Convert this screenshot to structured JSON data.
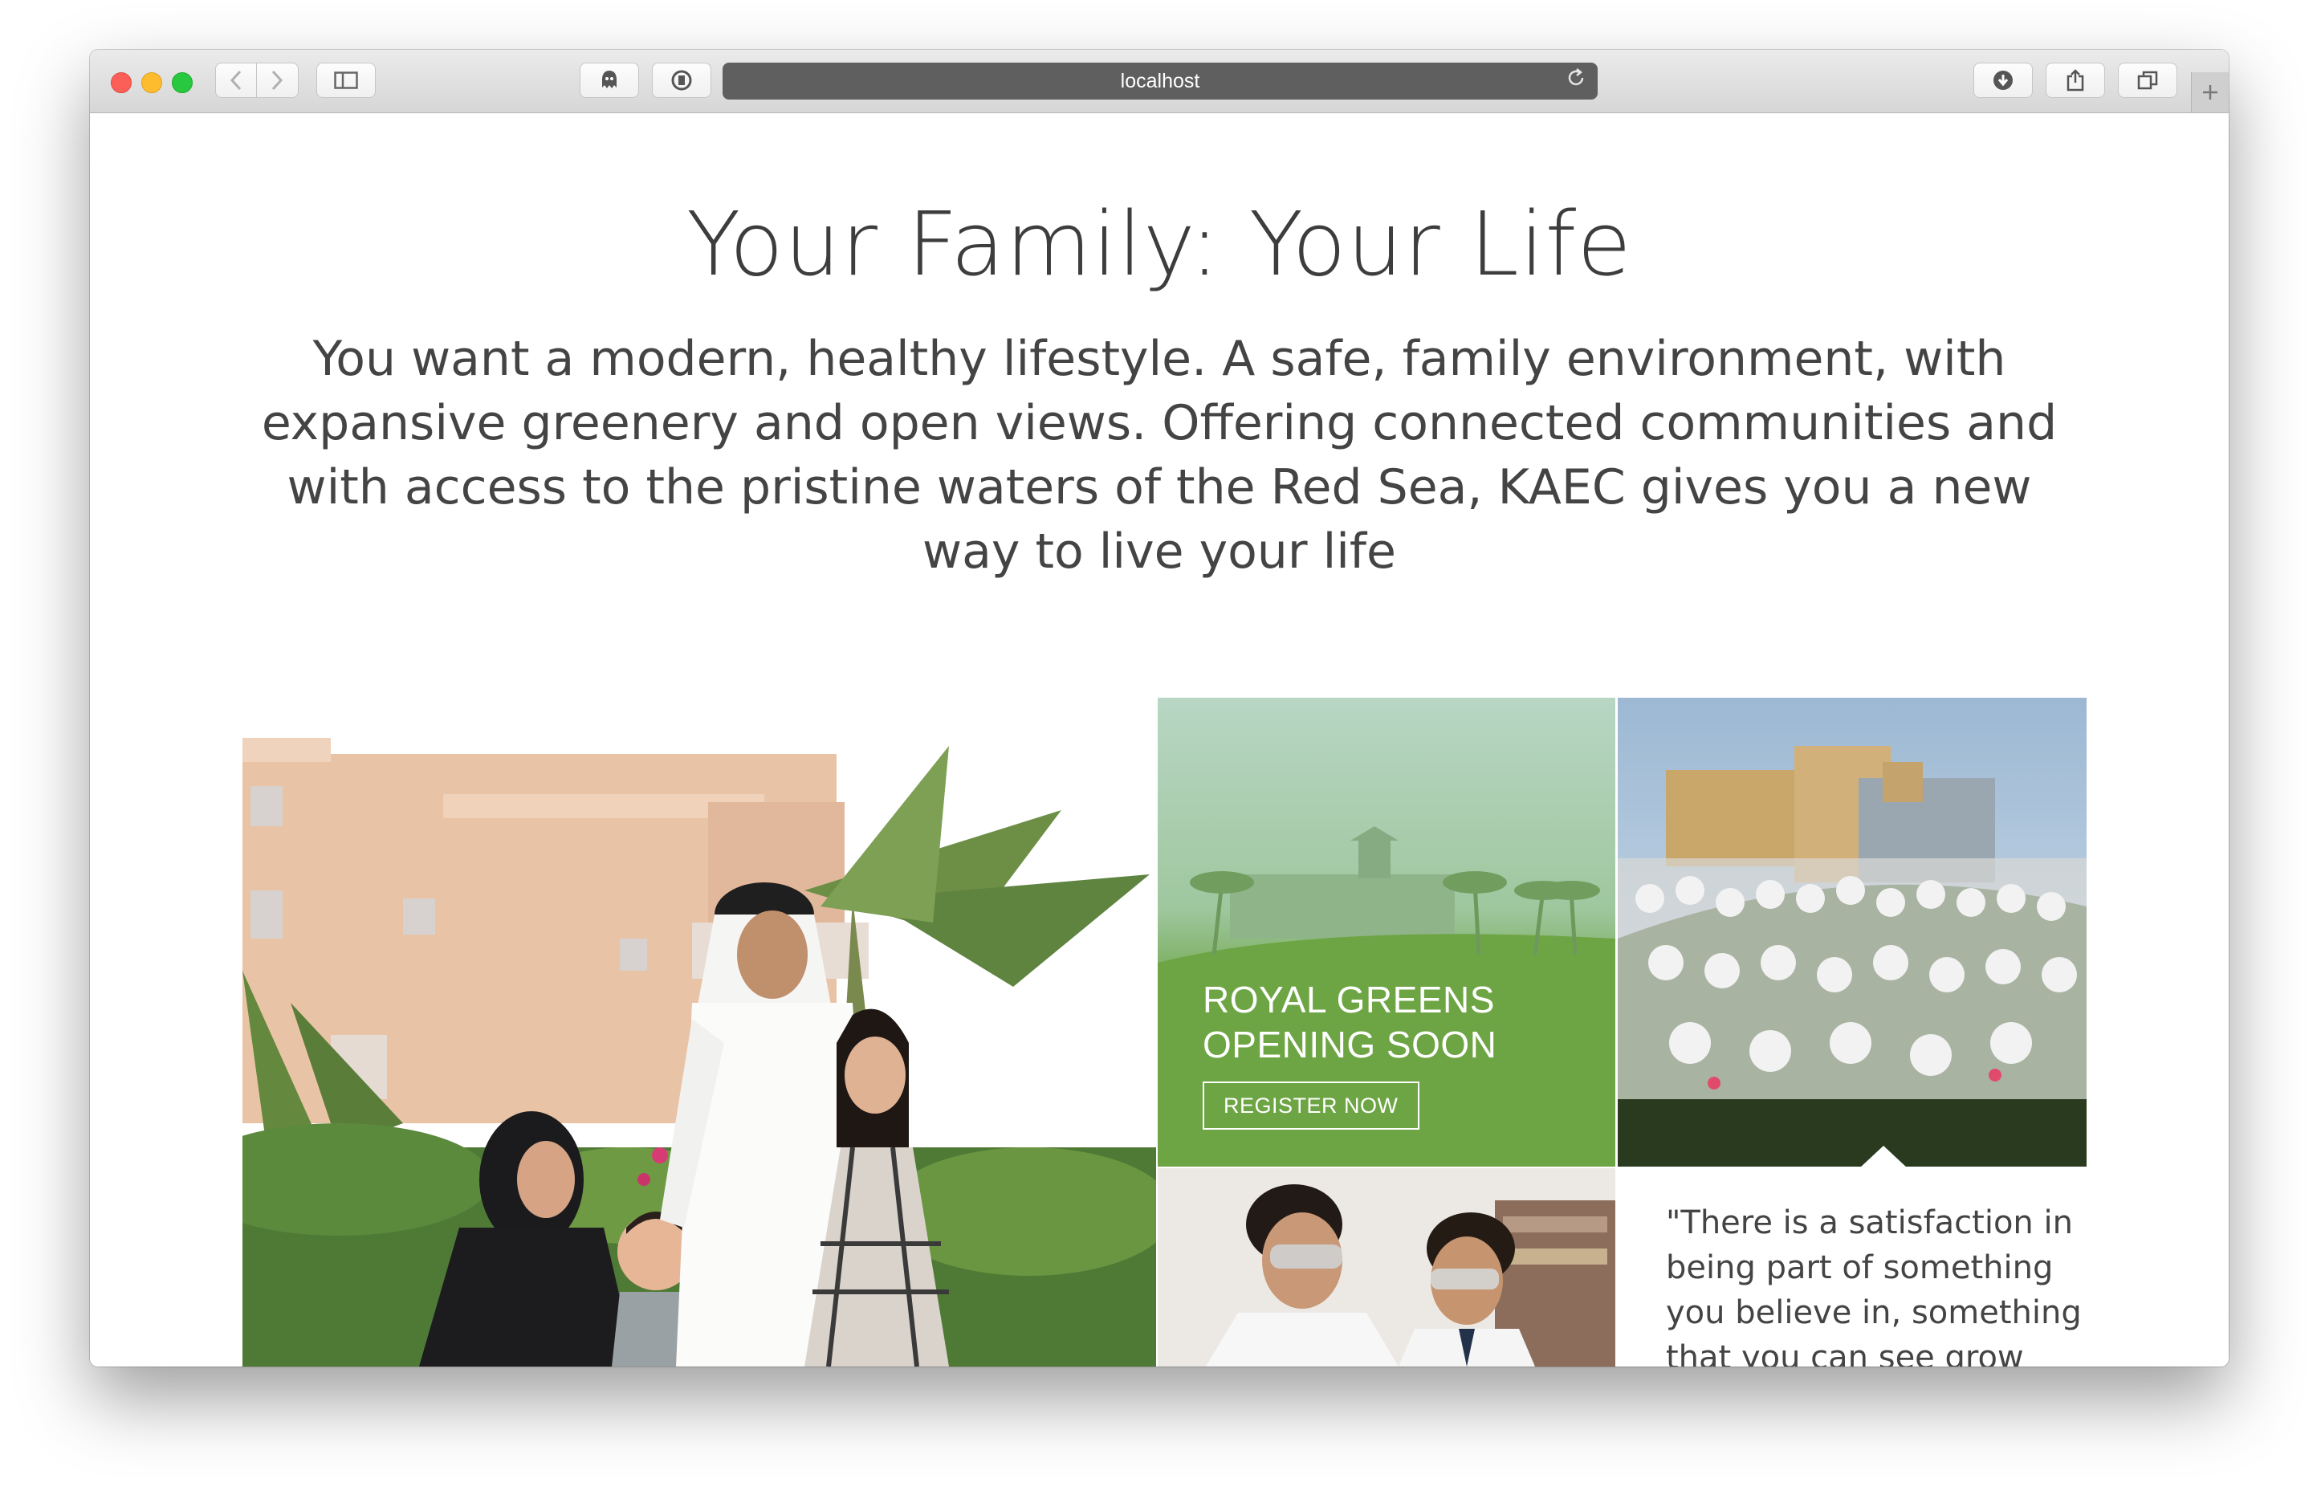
{
  "browser": {
    "url": "localhost",
    "icons": {
      "back": "chevron-left-icon",
      "forward": "chevron-right-icon",
      "sidebar": "sidebar-icon",
      "ghost": "ghostery-icon",
      "shield": "privacy-shield-icon",
      "reload": "reload-icon",
      "download": "download-icon",
      "share": "share-icon",
      "tabs": "tab-overview-icon",
      "new_tab": "plus-icon"
    }
  },
  "page": {
    "title": "Your Family: Your Life",
    "lead": "You want a modern, healthy lifestyle. A safe, family environment, with expansive greenery and open views. Offering connected communities and with access to the pristine waters of the Red Sea, KAEC gives you a new way to live your life",
    "promo": {
      "line1": "ROYAL GREENS",
      "line2": "OPENING SOON",
      "button": "REGISTER NOW"
    },
    "quote": "\"There is a satisfaction in being part of something you believe in, something that you can see grow"
  },
  "colors": {
    "promo_green": "#5f9e33",
    "text": "#444444"
  }
}
